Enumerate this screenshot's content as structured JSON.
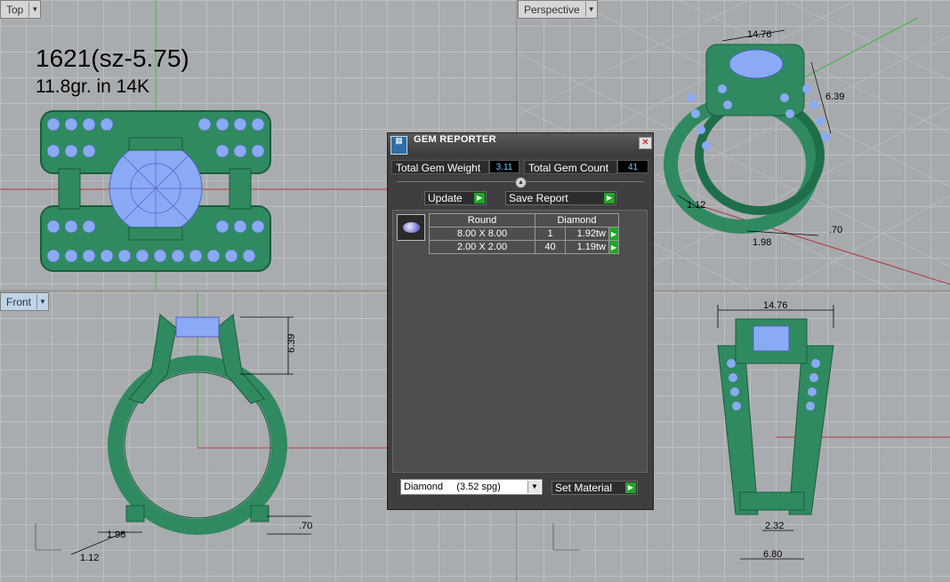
{
  "viewports": {
    "top": {
      "label": "Top"
    },
    "perspective": {
      "label": "Perspective"
    },
    "front": {
      "label": "Front"
    }
  },
  "notes": {
    "line1": "1621(sz-5.75)",
    "line2": "11.8gr.  in 14K"
  },
  "dimensions": {
    "front_height": "6.39",
    "front_a": "1.98",
    "front_b": "1.12",
    "front_c": ".70",
    "right_top": "14.76",
    "right_b1": "2.32",
    "right_b2": "6.80",
    "persp_top": "14.76",
    "persp_side": "6.39",
    "persp_a": "1.12",
    "persp_b": "1.98",
    "persp_c": ".70"
  },
  "gem_reporter": {
    "title": "GEM REPORTER",
    "total_weight_label": "Total Gem Weight",
    "total_weight_value": "3.11",
    "total_count_label": "Total Gem Count",
    "total_count_value": "41",
    "update_label": "Update",
    "save_report_label": "Save Report",
    "table": {
      "headers": [
        "Round",
        "Diamond"
      ],
      "rows": [
        {
          "size": "8.00 X 8.00",
          "count": "1",
          "weight": "1.92tw"
        },
        {
          "size": "2.00 X 2.00",
          "count": "40",
          "weight": "1.19tw"
        }
      ]
    },
    "material_selected": "Diamond     (3.52 spg)",
    "set_material_label": "Set Material"
  },
  "colors": {
    "ring_green": "#2f8a60",
    "gem_blue": "#8aaaf5",
    "axis_red": "#b23a3a",
    "axis_green": "#3cb43c"
  }
}
